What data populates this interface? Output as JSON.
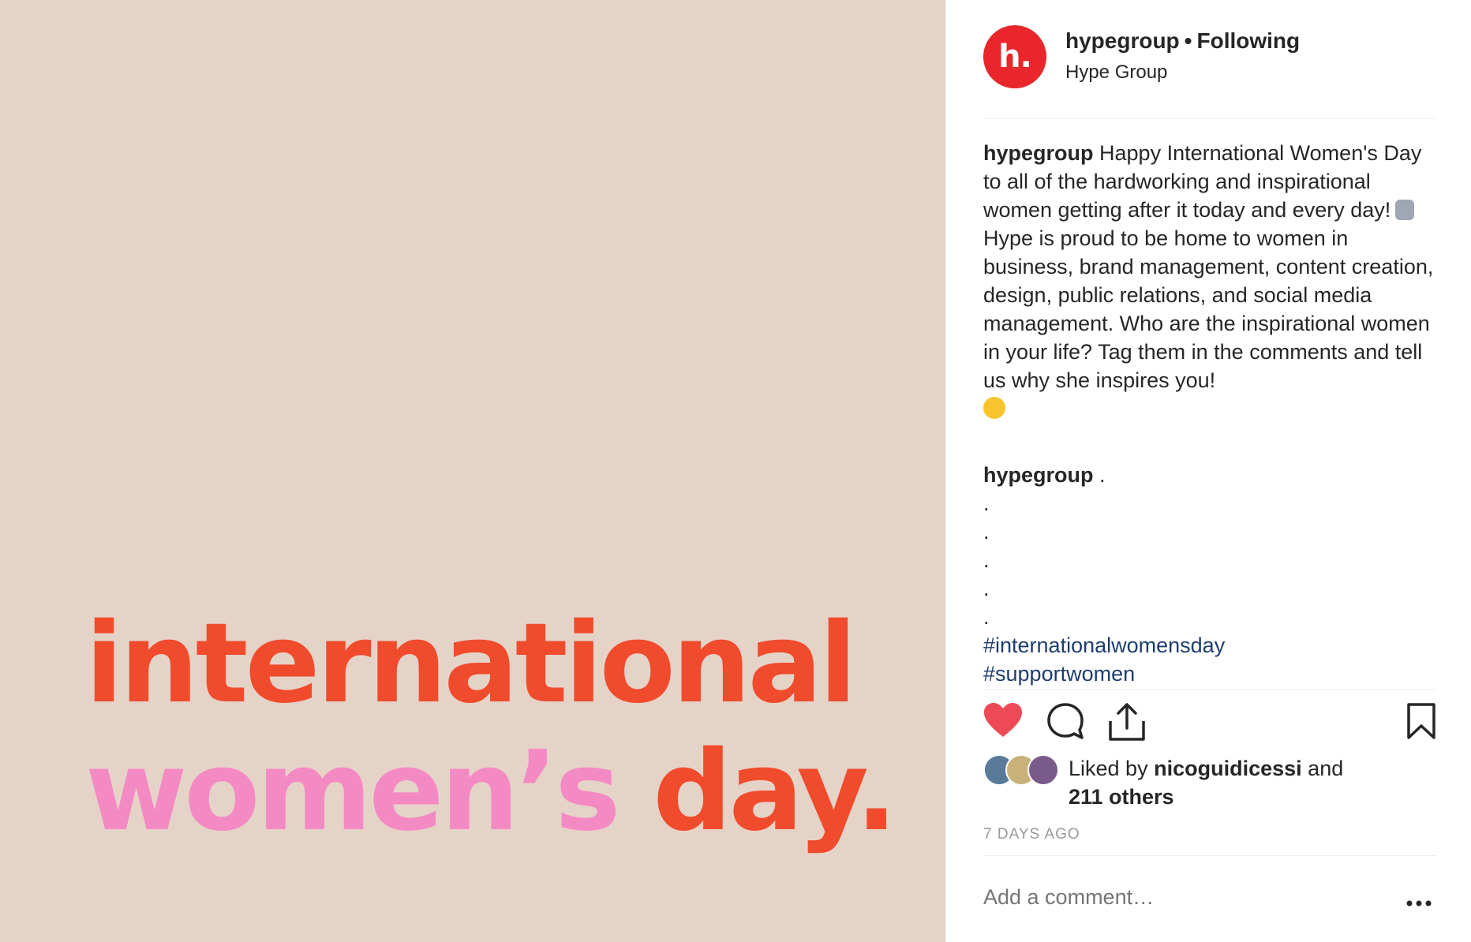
{
  "post_image": {
    "line1": "international",
    "line2_pink": "women’s",
    "line2_red": "day."
  },
  "header": {
    "avatar_letter": "h.",
    "username": "hypegroup",
    "separator": "•",
    "follow_status": "Following",
    "display_name": "Hype Group"
  },
  "caption": {
    "username": "hypegroup",
    "text_part1": "Happy International Women's Day to all of the hardworking and inspirational women getting after it today and every day!",
    "text_part2": "Hype is proud to be home to women in business, brand management, content creation, design, public relations, and social media management. Who are the inspirational women in your life? Tag them in the comments and tell us why she inspires you!"
  },
  "comment2": {
    "username": "hypegroup",
    "text": ".",
    "dots": [
      ".",
      ".",
      ".",
      ".",
      "."
    ],
    "hashtags": [
      "#internationalwomensday",
      "#supportwomen"
    ]
  },
  "actions": {
    "like_icon": "heart-icon",
    "comment_icon": "comment-icon",
    "share_icon": "share-icon",
    "save_icon": "bookmark-icon"
  },
  "likes": {
    "prefix": "Liked by",
    "user": "nicoguidicessi",
    "connector": "and",
    "others": "211 others"
  },
  "timestamp": "7 DAYS AGO",
  "comment_box": {
    "placeholder": "Add a comment…"
  },
  "colors": {
    "brand_red": "#e8262b",
    "headline_red": "#f04b2d",
    "headline_pink": "#f48ac4",
    "image_bg": "#e6d3c8",
    "like_red": "#ed4956",
    "hashtag_blue": "#1e3d6e"
  }
}
